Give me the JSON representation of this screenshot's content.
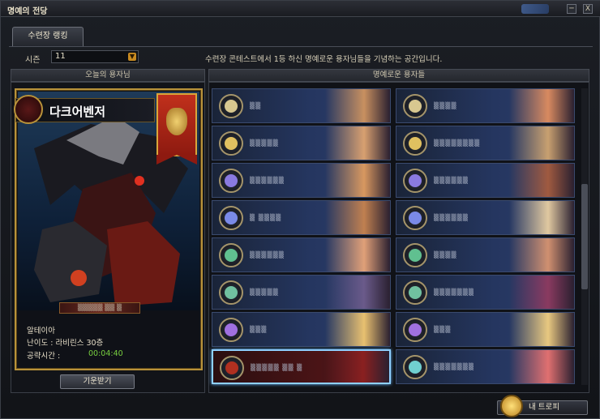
{
  "window": {
    "title": "명예의 전당",
    "minimize_glyph": "─",
    "close_glyph": "X"
  },
  "tabs": [
    {
      "label": "수련장 랭킹"
    }
  ],
  "season": {
    "label": "시즌",
    "value": "11",
    "arrow_icon": "chevron-down-icon"
  },
  "subtitle": "수련장 콘테스트에서 1등 하신 명예로운 용자님들을 기념하는 공간입니다.",
  "today_hero": {
    "header": "오늘의 용자님",
    "character_name": "다크어벤저",
    "player_name": "▒▒▒▒▒ ▒▒ ▒",
    "server": "알테이아",
    "difficulty_label": "난이도 : 라비린스 30층",
    "clear_time_label": "공략시간 :",
    "clear_time_value": "00:04:40",
    "button_label": "기운받기"
  },
  "honored": {
    "header": "명예로운 용자들",
    "left_entries": [
      {
        "name": "▒▒",
        "medal_color": "#d8c890",
        "portrait": "#c89060"
      },
      {
        "name": "▒▒▒▒▒",
        "medal_color": "#e0c060",
        "portrait": "#d8a070"
      },
      {
        "name": "▒▒▒▒▒▒",
        "medal_color": "#8a7ae0",
        "portrait": "#d89860"
      },
      {
        "name": "▒ ▒▒▒▒",
        "medal_color": "#7a8ae8",
        "portrait": "#c08050"
      },
      {
        "name": "▒▒▒▒▒▒",
        "medal_color": "#60c090",
        "portrait": "#e0a078"
      },
      {
        "name": "▒▒▒▒▒",
        "medal_color": "#70c0a0",
        "portrait": "#6a5a8a"
      },
      {
        "name": "▒▒▒",
        "medal_color": "#a070e0",
        "portrait": "#e8c070"
      },
      {
        "name": "▒▒▒▒▒ ▒▒ ▒",
        "medal_color": "#b03020",
        "portrait": "#8a2020"
      }
    ],
    "right_entries": [
      {
        "name": "▒▒▒▒",
        "medal_color": "#d8c890",
        "portrait": "#d88a60"
      },
      {
        "name": "▒▒▒▒▒▒▒▒",
        "medal_color": "#e0c060",
        "portrait": "#c8a070"
      },
      {
        "name": "▒▒▒▒▒▒",
        "medal_color": "#8a7ae0",
        "portrait": "#a05a40"
      },
      {
        "name": "▒▒▒▒▒▒",
        "medal_color": "#7a8ae8",
        "portrait": "#e0c8a0"
      },
      {
        "name": "▒▒▒▒",
        "medal_color": "#60c090",
        "portrait": "#d09070"
      },
      {
        "name": "▒▒▒▒▒▒▒",
        "medal_color": "#70c0a0",
        "portrait": "#8a3a60"
      },
      {
        "name": "▒▒▒",
        "medal_color": "#a070e0",
        "portrait": "#e8c880"
      },
      {
        "name": "▒▒▒▒▒▒▒",
        "medal_color": "#70d0d0",
        "portrait": "#e07070"
      }
    ]
  },
  "trophy_button": {
    "label": "내 트로피",
    "icon": "trophy-icon"
  }
}
